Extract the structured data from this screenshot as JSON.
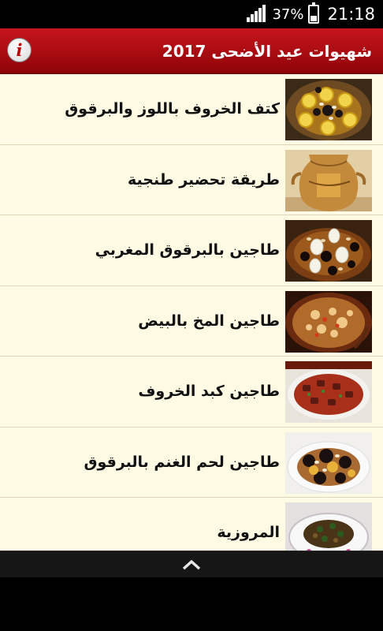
{
  "status_bar": {
    "battery_percent": "37%",
    "battery_level": 0.37,
    "time": "21:18",
    "icons": [
      "signal-icon",
      "battery-icon"
    ]
  },
  "header": {
    "title": "شهيوات عيد الأضحى 2017",
    "info_icon": "info-icon",
    "info_glyph": "i",
    "background": "#b00d14"
  },
  "recipes": [
    {
      "title": "كتف الخروف باللوز والبرقوق",
      "thumb": "lamb-shoulder-almond-prune-photo"
    },
    {
      "title": "طريقة تحضير طنجية",
      "thumb": "tanjia-pot-photo"
    },
    {
      "title": "طاجين بالبرقوق المغربي",
      "thumb": "moroccan-prune-tagine-photo"
    },
    {
      "title": "طاجين المخ بالبيض",
      "thumb": "brain-egg-tagine-photo"
    },
    {
      "title": "طاجين كبد الخروف",
      "thumb": "lamb-liver-tagine-photo"
    },
    {
      "title": "طاجين لحم الغنم بالبرقوق",
      "thumb": "mutton-prune-tagine-photo"
    },
    {
      "title": "المروزية",
      "thumb": "mrouzia-photo"
    }
  ],
  "bottom_bar": {
    "icon": "chevron-up-icon"
  },
  "colors": {
    "list_background": "#fefae3",
    "divider": "#ddd6b6",
    "header_red": "#b00d14"
  }
}
